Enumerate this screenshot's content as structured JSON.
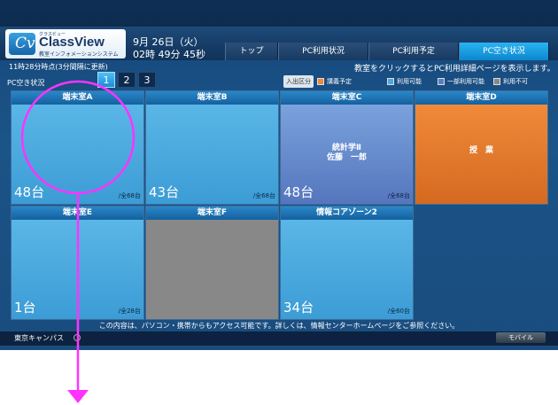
{
  "header": {
    "logo_small": "クラスビュー",
    "logo_name": "ClassView",
    "logo_sub": "教室インフォメーションシステム",
    "date": "9月 26日（火）",
    "time": "02時 49分 45秒",
    "tabs": [
      {
        "label": "トップ",
        "active": false
      },
      {
        "label": "PC利用状況",
        "active": false
      },
      {
        "label": "PC利用予定",
        "active": false
      },
      {
        "label": "PC空き状況",
        "active": true
      }
    ]
  },
  "subbar": {
    "updated": "11時28分時点(3分間隔に更新)",
    "status_label": "PC空き状況",
    "pages": [
      "1",
      "2",
      "3"
    ],
    "active_page": "1",
    "hint": "教室をクリックするとPC利用詳細ページを表示します。",
    "legend_title": "入出区分",
    "legend": [
      {
        "label": "講義予定",
        "color": "#f0883a"
      },
      {
        "label": "利用可能",
        "color": "#4aa8e0"
      },
      {
        "label": "一部利用可能",
        "color": "#5a7ec4"
      },
      {
        "label": "利用不可",
        "color": "#888888"
      }
    ]
  },
  "rooms": [
    {
      "name": "端末室A",
      "count": "48台",
      "total": "/全68台",
      "status": "available",
      "info": ""
    },
    {
      "name": "端末室B",
      "count": "43台",
      "total": "/全68台",
      "status": "available",
      "info": ""
    },
    {
      "name": "端末室C",
      "count": "48台",
      "total": "/全68台",
      "status": "partial",
      "info": "統計学Ⅱ\n佐藤　一郎"
    },
    {
      "name": "端末室D",
      "count": "",
      "total": "",
      "status": "class",
      "info": "授　業"
    },
    {
      "name": "端末室E",
      "count": "1台",
      "total": "/全28台",
      "status": "available",
      "info": ""
    },
    {
      "name": "端末室F",
      "count": "",
      "total": "",
      "status": "closed",
      "info": ""
    },
    {
      "name": "情報コアゾーン2",
      "count": "34台",
      "total": "/全60台",
      "status": "available",
      "info": ""
    }
  ],
  "footer": {
    "notice": "この内容は、パソコン・携帯からもアクセス可能です。詳しくは、情報センターホームページをご参照ください。",
    "campus": "東京キャンパス",
    "mobile": "モバイル"
  },
  "annotation_color": "#ff33ff"
}
